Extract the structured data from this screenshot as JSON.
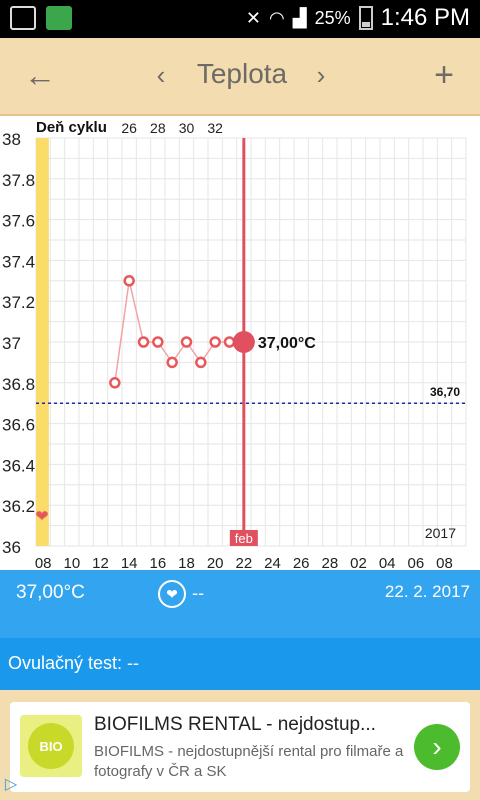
{
  "status_bar": {
    "battery": "25%",
    "time": "1:46 PM"
  },
  "toolbar": {
    "title": "Teplota",
    "back_icon": "arrow-left",
    "prev_icon": "chevron-left",
    "next_icon": "chevron-right",
    "add_icon": "plus"
  },
  "chart_data": {
    "type": "line",
    "title": "Deň cyklu",
    "y_ticks": [
      "38",
      "37.8",
      "37.6",
      "37.4",
      "37.2",
      "37",
      "36.8",
      "36.6",
      "36.4",
      "36.2",
      "36"
    ],
    "ylim": [
      36,
      38
    ],
    "x_ticks": [
      "08",
      "10",
      "12",
      "14",
      "16",
      "18",
      "20",
      "22",
      "24",
      "26",
      "28",
      "02",
      "04",
      "06",
      "08"
    ],
    "cycle_day_ticks": [
      "26",
      "28",
      "30",
      "32"
    ],
    "series": [
      {
        "values": [
          {
            "x": 13,
            "y": 36.8
          },
          {
            "x": 14,
            "y": 37.3
          },
          {
            "x": 15,
            "y": 37.0
          },
          {
            "x": 16,
            "y": 37.0
          },
          {
            "x": 17,
            "y": 36.9
          },
          {
            "x": 18,
            "y": 37.0
          },
          {
            "x": 19,
            "y": 36.9
          },
          {
            "x": 20,
            "y": 37.0
          },
          {
            "x": 21,
            "y": 37.0
          },
          {
            "x": 22,
            "y": 37.0
          }
        ]
      }
    ],
    "baseline": {
      "value": 36.7,
      "label": "36,70"
    },
    "selected": {
      "x": 22,
      "y": 37.0,
      "label": "37,00°C"
    },
    "month_label": "feb",
    "year_label": "2017",
    "colors": {
      "line": "#f4a3a3",
      "point": "#e8585b",
      "selected": "#e0505f",
      "baseline": "#1f2d9c",
      "grid": "#e6e6e6",
      "band": "#f9dc6a"
    }
  },
  "info_bar": {
    "temperature": "37,00°C",
    "mucus": "--",
    "date": "22. 2. 2017"
  },
  "ovulation": {
    "label": "Ovulačný test: --"
  },
  "ad": {
    "title": "BIOFILMS RENTAL - nejdostup...",
    "description": "BIOFILMS - nejdostupnější rental pro filmaře a fotografy v ČR a SK",
    "logo_text": "BIO"
  }
}
